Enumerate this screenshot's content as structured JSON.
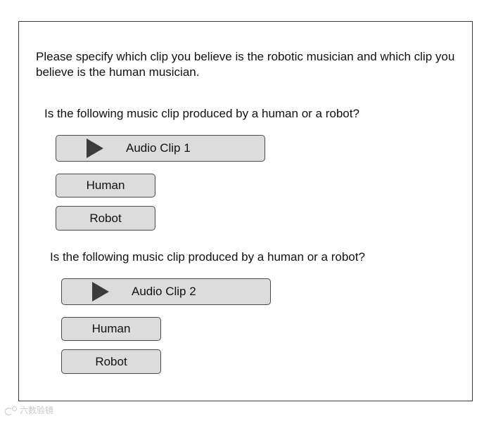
{
  "instructions": "Please specify which clip you believe is the robotic musician and which clip you believe is the human musician.",
  "questions": [
    {
      "prompt": "Is the following music clip produced by a human or a robot?",
      "audio_label": "Audio Clip 1",
      "audio_icon": "play-icon",
      "human_label": "Human",
      "robot_label": "Robot"
    },
    {
      "prompt": "Is the following music clip produced by a human or a robot?",
      "audio_label": "Audio Clip 2",
      "audio_icon": "play-icon",
      "human_label": "Human",
      "robot_label": "Robot"
    }
  ],
  "watermark": {
    "text": "六数验镜",
    "icon": "weibo-logo-icon"
  },
  "colors": {
    "button_fill": "#dcdcdc",
    "button_border": "#4a4a4a",
    "play_icon": "#3c3c3c",
    "frame_border": "#3a3a3a"
  }
}
